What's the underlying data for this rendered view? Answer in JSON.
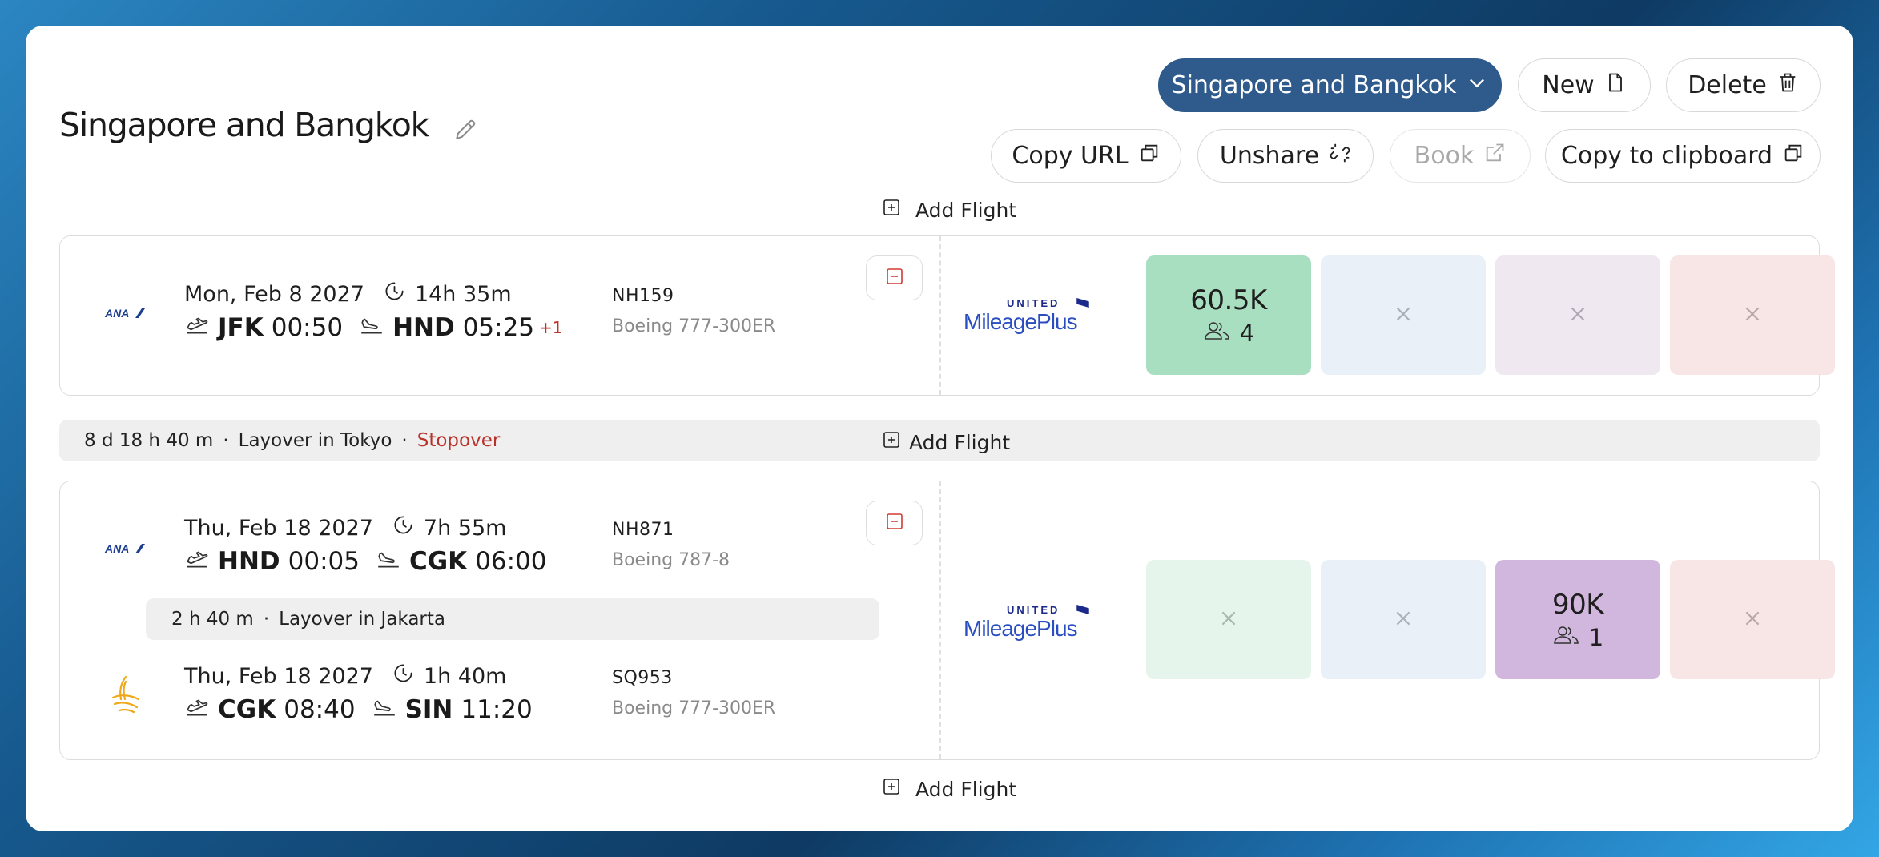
{
  "trip": {
    "title": "Singapore and Bangkok"
  },
  "toolbar": {
    "trip_select": "Singapore and Bangkok",
    "new": "New",
    "delete": "Delete",
    "copy_url": "Copy URL",
    "unshare": "Unshare",
    "book": "Book",
    "copy_clipboard": "Copy to clipboard"
  },
  "add_flight": "Add Flight",
  "program": {
    "line1": "UNITED",
    "line2": "MileagePlus"
  },
  "colors": {
    "primary": "#2e5a8c",
    "economy": "#a8dfc1",
    "premium": "#e9f0f7",
    "business": "#d1b6dd",
    "first": "#f8e5e6",
    "alert": "#c0322a"
  },
  "segments": [
    {
      "airline_logo": "ANA",
      "date": "Mon, Feb 8 2027",
      "duration": "14h 35m",
      "from_code": "JFK",
      "dep_time": "00:50",
      "to_code": "HND",
      "arr_time": "05:25",
      "day_offset": "+1",
      "flight_no": "NH159",
      "aircraft": "Boeing 777-300ER"
    },
    {
      "airline_logo": "ANA",
      "date": "Thu, Feb 18 2027",
      "duration": "7h 55m",
      "from_code": "HND",
      "dep_time": "00:05",
      "to_code": "CGK",
      "arr_time": "06:00",
      "flight_no": "NH871",
      "aircraft": "Boeing 787-8"
    },
    {
      "airline_logo": "singapore-airlines-bird-icon",
      "date": "Thu, Feb 18 2027",
      "duration": "1h 40m",
      "from_code": "CGK",
      "dep_time": "08:40",
      "to_code": "SIN",
      "arr_time": "11:20",
      "flight_no": "SQ953",
      "aircraft": "Boeing 777-300ER"
    }
  ],
  "layovers": [
    {
      "duration": "8 d 18 h 40 m",
      "text": "Layover in Tokyo",
      "tag": "Stopover"
    },
    {
      "duration": "2 h 40 m",
      "text": "Layover in Jakarta"
    }
  ],
  "availability": [
    [
      {
        "points": "60.5K",
        "seats": "4"
      },
      null,
      null,
      null
    ],
    [
      null,
      null,
      {
        "points": "90K",
        "seats": "1"
      },
      null
    ]
  ]
}
